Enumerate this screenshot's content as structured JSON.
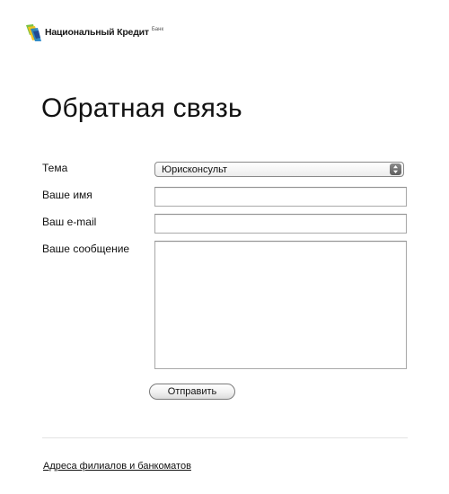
{
  "logo": {
    "name": "Национальный Кредит",
    "sub": "Банк",
    "colors": {
      "green": "#7cc243",
      "yellow": "#f6c31b",
      "blue": "#1c7fc4",
      "navy": "#1d3f8c"
    }
  },
  "page": {
    "title": "Обратная связь"
  },
  "form": {
    "topic": {
      "label": "Тема",
      "selected": "Юрисконсульт"
    },
    "name": {
      "label": "Ваше имя",
      "value": ""
    },
    "email": {
      "label": "Ваш e-mail",
      "value": ""
    },
    "message": {
      "label": "Ваше сообщение",
      "value": ""
    },
    "submit_label": "Отправить"
  },
  "footer": {
    "link_label": "Адреса филиалов и банкоматов"
  }
}
